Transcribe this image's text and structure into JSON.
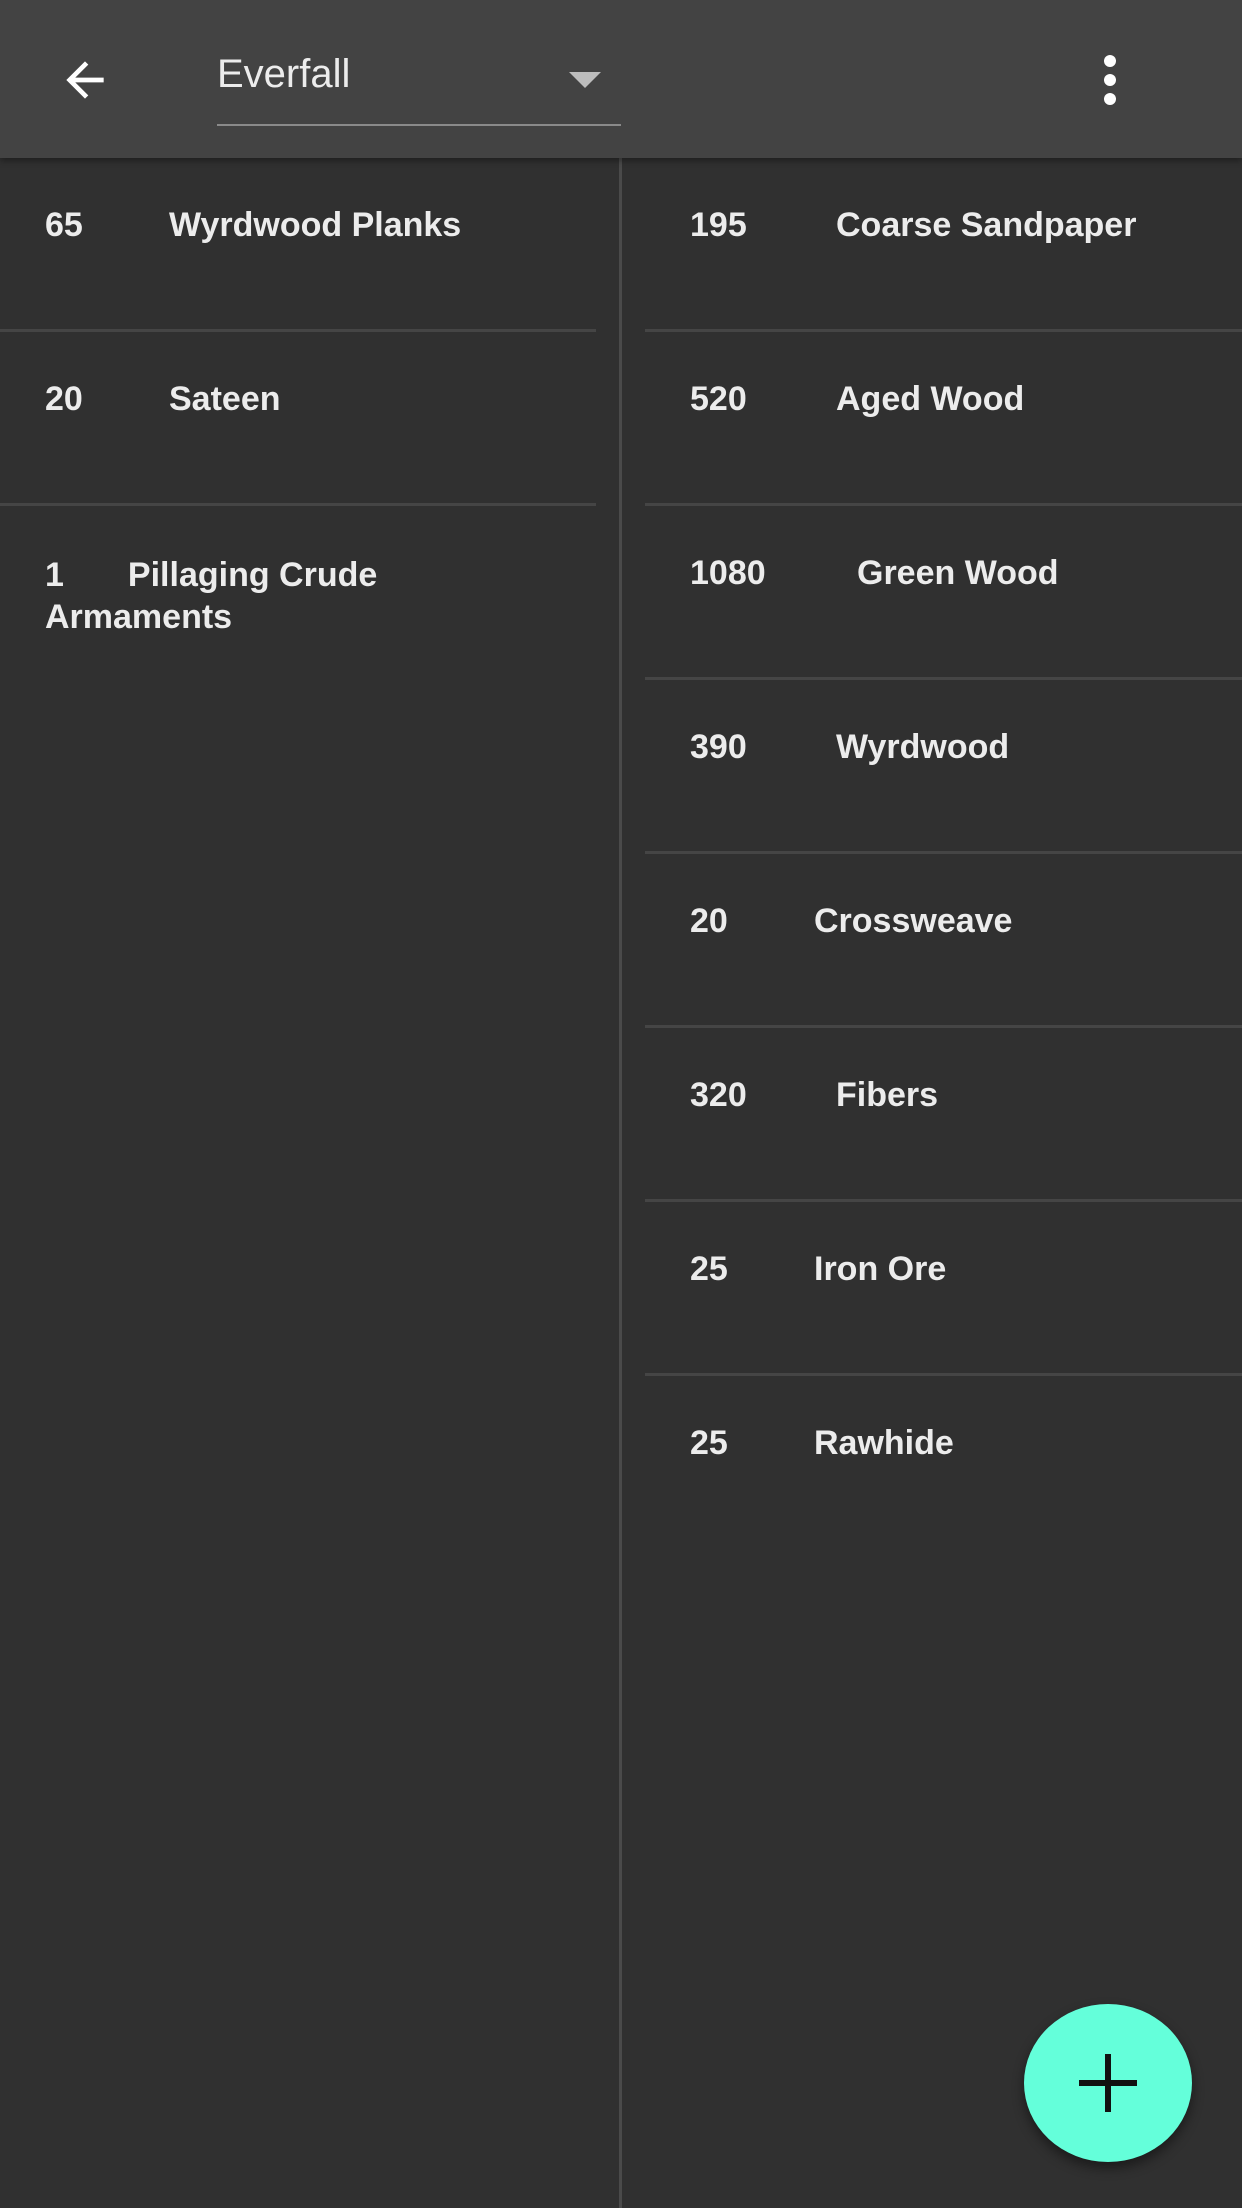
{
  "toolbar": {
    "selected_location": "Everfall",
    "back_icon": "arrow-left-icon",
    "menu_icon": "more-vertical-icon"
  },
  "left_list": [
    {
      "qty": "65",
      "name": "Wyrdwood Planks"
    },
    {
      "qty": "20",
      "name": "Sateen"
    },
    {
      "qty": "1",
      "name": "Pillaging Crude Armaments"
    }
  ],
  "right_list": [
    {
      "qty": "195",
      "name": "Coarse Sandpaper"
    },
    {
      "qty": "520",
      "name": "Aged Wood"
    },
    {
      "qty": "1080",
      "name": "Green Wood"
    },
    {
      "qty": "390",
      "name": "Wyrdwood"
    },
    {
      "qty": "20",
      "name": "Crossweave"
    },
    {
      "qty": "320",
      "name": "Fibers"
    },
    {
      "qty": "25",
      "name": "Iron Ore"
    },
    {
      "qty": "25",
      "name": "Rawhide"
    }
  ],
  "fab": {
    "icon": "plus-icon"
  },
  "colors": {
    "background": "#303030",
    "toolbar": "#434343",
    "accent": "#64ffda",
    "text": "#ececec"
  }
}
